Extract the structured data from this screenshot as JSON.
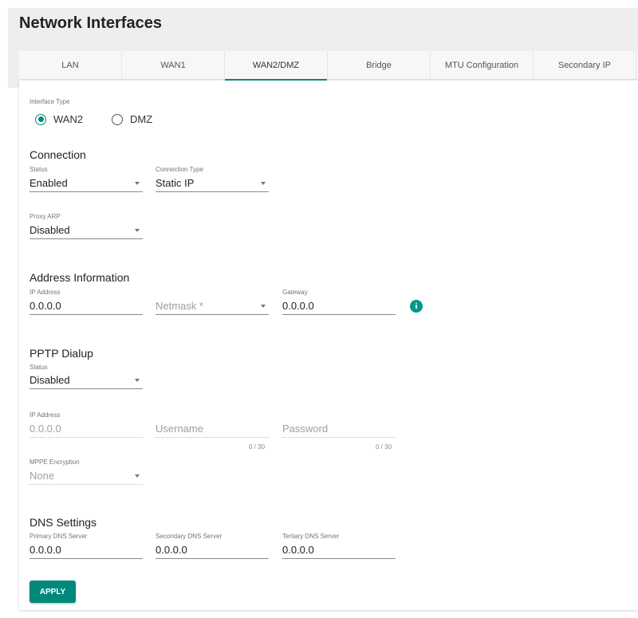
{
  "page": {
    "title": "Network Interfaces"
  },
  "tabs": [
    {
      "label": "LAN"
    },
    {
      "label": "WAN1"
    },
    {
      "label": "WAN2/DMZ",
      "active": true
    },
    {
      "label": "Bridge"
    },
    {
      "label": "MTU Configuration"
    },
    {
      "label": "Secondary IP"
    }
  ],
  "interface_type": {
    "label": "Interface Type",
    "options": [
      {
        "label": "WAN2",
        "selected": true
      },
      {
        "label": "DMZ",
        "selected": false
      }
    ]
  },
  "connection": {
    "title": "Connection",
    "status": {
      "label": "Status",
      "value": "Enabled"
    },
    "connection_type": {
      "label": "Connection Type",
      "value": "Static IP"
    },
    "proxy_arp": {
      "label": "Proxy ARP",
      "value": "Disabled"
    }
  },
  "address_information": {
    "title": "Address Information",
    "ip_address": {
      "label": "IP Address",
      "value": "0.0.0.0"
    },
    "netmask": {
      "placeholder": "Netmask *"
    },
    "gateway": {
      "label": "Gateway",
      "value": "0.0.0.0"
    },
    "info_icon": "info-icon"
  },
  "pptp_dialup": {
    "title": "PPTP Dialup",
    "status": {
      "label": "Status",
      "value": "Disabled"
    },
    "ip_address": {
      "label": "IP Address",
      "value": "0.0.0.0"
    },
    "username": {
      "placeholder": "Username",
      "counter": "0 / 30"
    },
    "password": {
      "placeholder": "Password",
      "counter": "0 / 30"
    },
    "mppe_encryption": {
      "label": "MPPE Encryption",
      "value": "None"
    }
  },
  "dns_settings": {
    "title": "DNS Settings",
    "primary": {
      "label": "Primary DNS Server",
      "value": "0.0.0.0"
    },
    "secondary": {
      "label": "Secondary DNS Server",
      "value": "0.0.0.0"
    },
    "tertiary": {
      "label": "Tertiary DNS Server",
      "value": "0.0.0.0"
    }
  },
  "actions": {
    "apply_label": "APPLY"
  },
  "colors": {
    "accent": "#00897b",
    "header_bg": "#eeeeee"
  }
}
